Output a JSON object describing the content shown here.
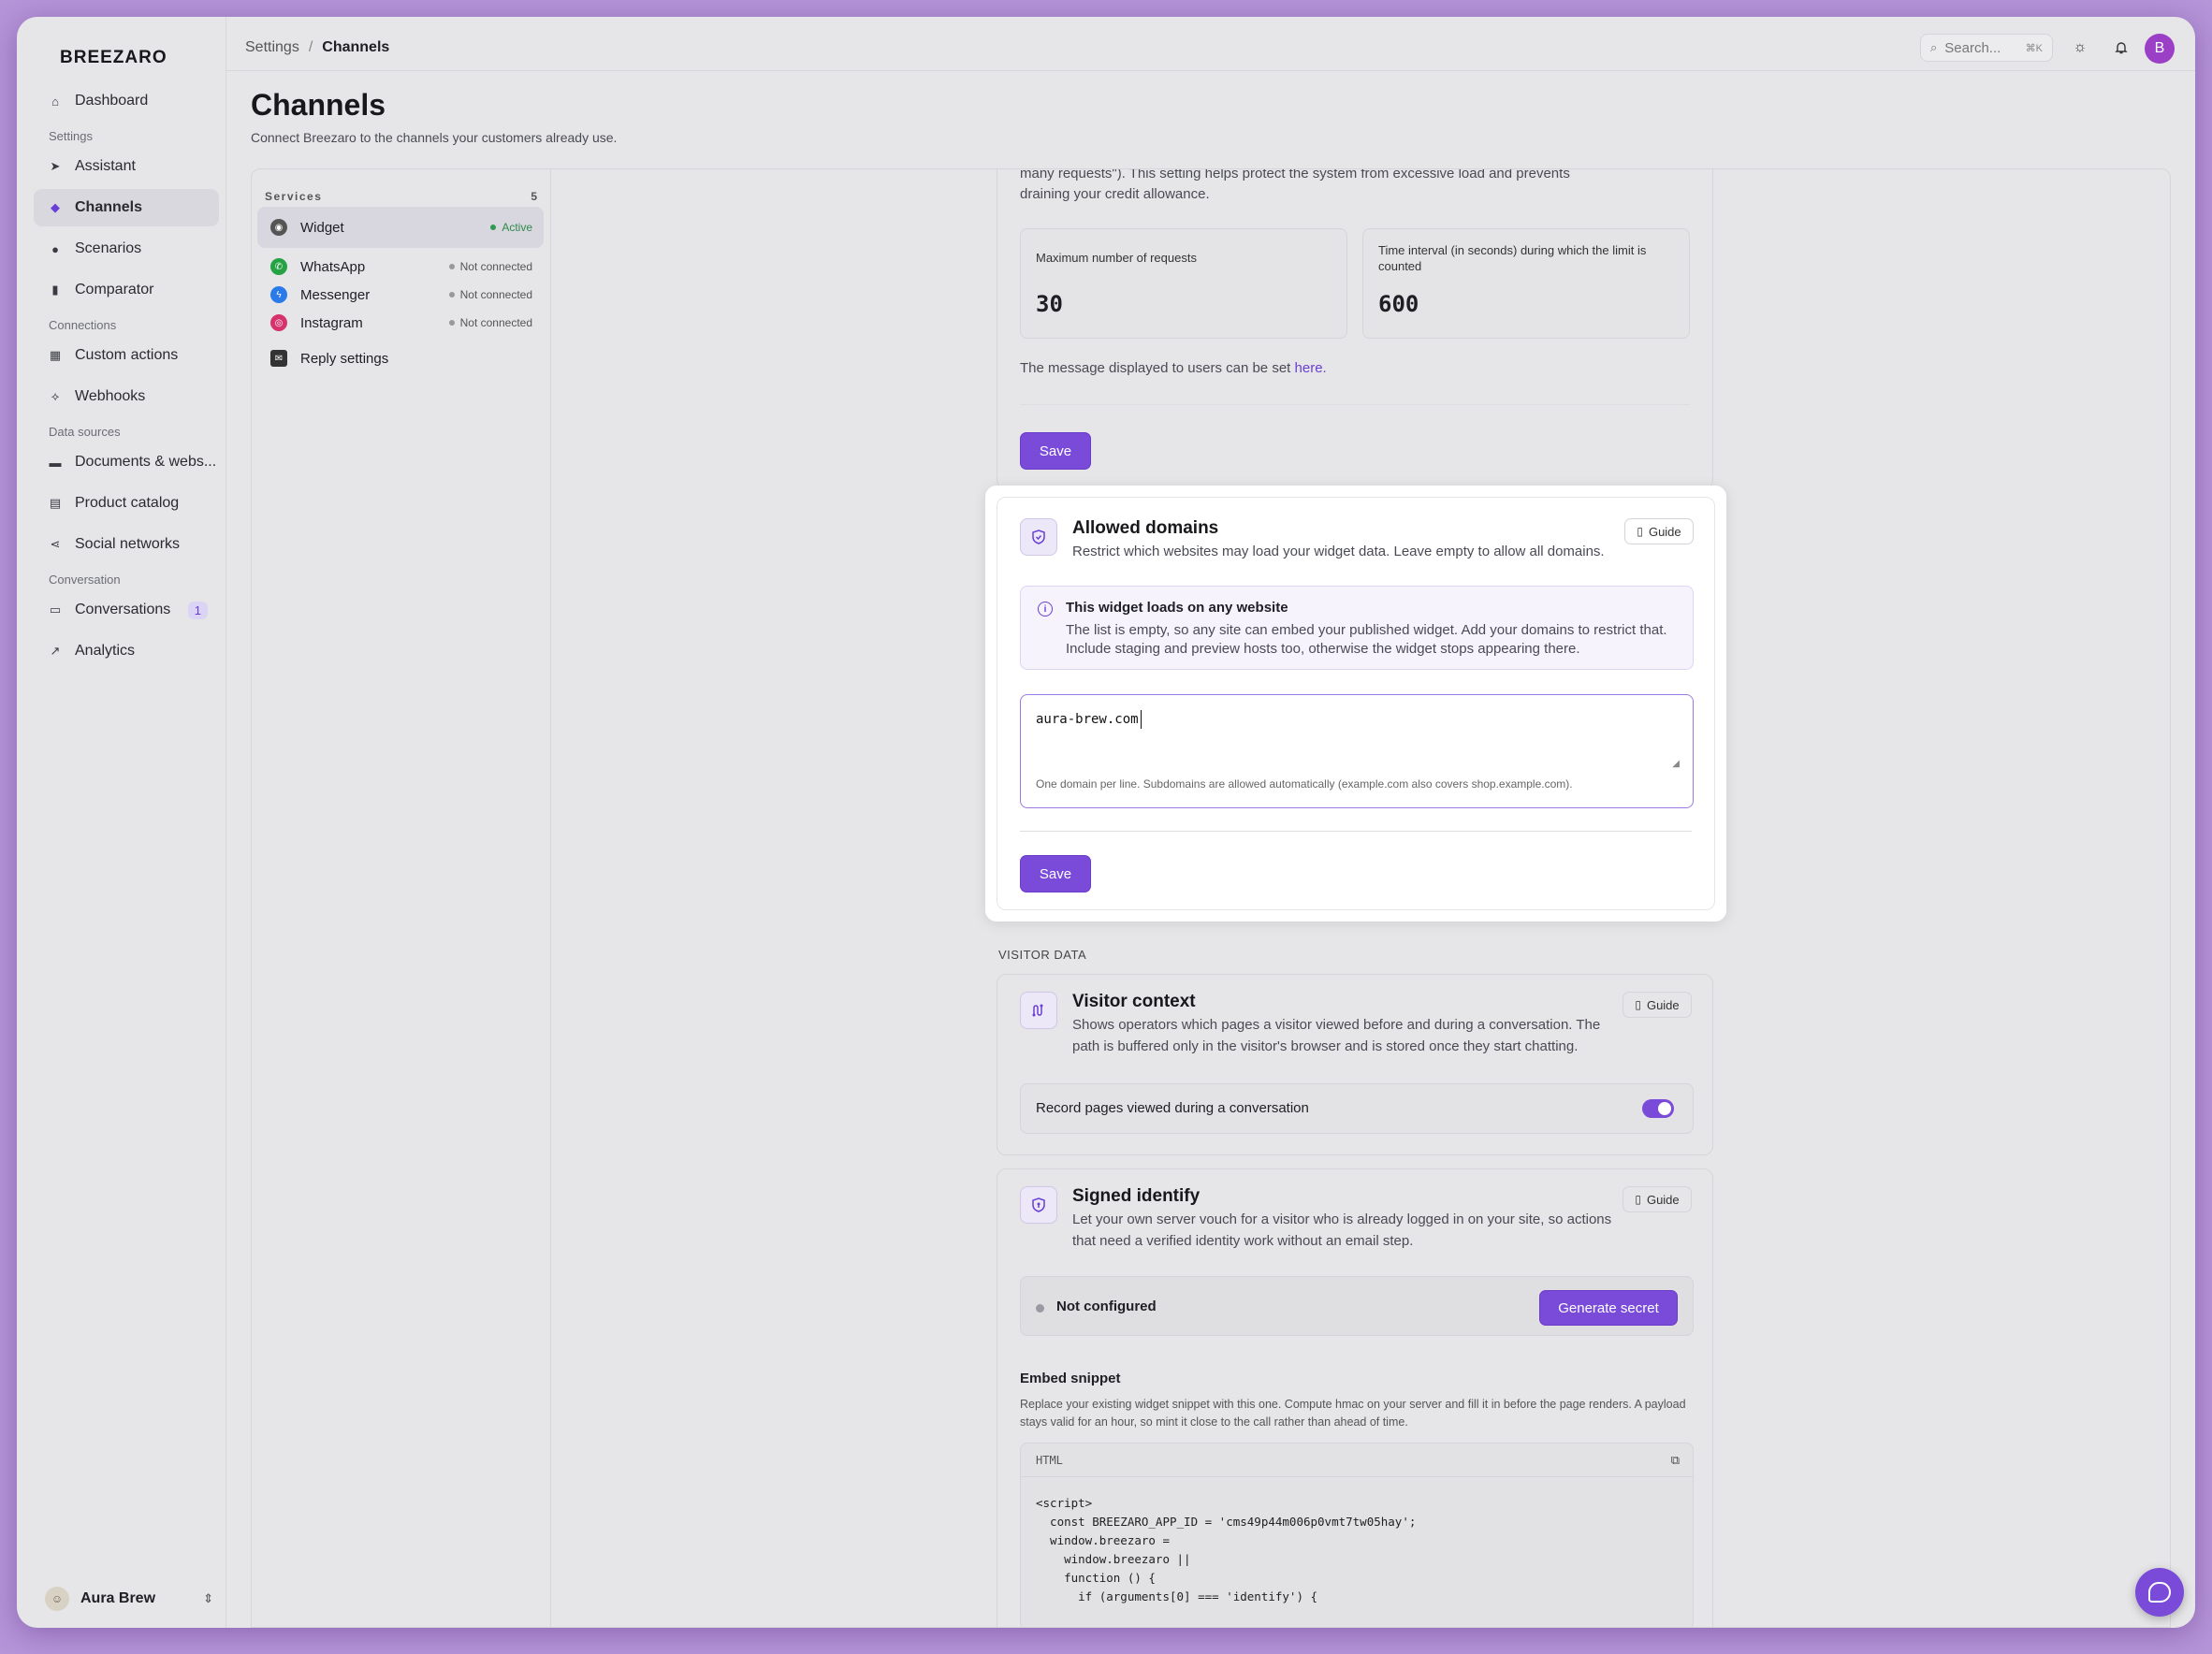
{
  "app": {
    "logo": "BREEZARO"
  },
  "sidebar": {
    "items": [
      {
        "label": "Dashboard",
        "icon": "home-icon"
      },
      {
        "section": "Settings"
      },
      {
        "label": "Assistant",
        "icon": "send-icon"
      },
      {
        "label": "Channels",
        "icon": "puzzle-icon",
        "active": true
      },
      {
        "label": "Scenarios",
        "icon": "chat-icon"
      },
      {
        "label": "Comparator",
        "icon": "columns-icon"
      },
      {
        "section": "Connections"
      },
      {
        "label": "Custom actions",
        "icon": "grid-icon"
      },
      {
        "label": "Webhooks",
        "icon": "webhook-icon"
      },
      {
        "section": "Data sources"
      },
      {
        "label": "Documents & webs...",
        "icon": "folder-icon"
      },
      {
        "label": "Product catalog",
        "icon": "store-icon"
      },
      {
        "label": "Social networks",
        "icon": "share-icon"
      },
      {
        "section": "Conversation"
      },
      {
        "label": "Conversations",
        "icon": "message-icon",
        "count": "1"
      },
      {
        "label": "Analytics",
        "icon": "chart-icon"
      }
    ],
    "org": {
      "name": "Aura Brew"
    }
  },
  "topbar": {
    "crumb_root": "Settings",
    "crumb_sep": "/",
    "crumb_current": "Channels",
    "search_placeholder": "Search...",
    "search_kbd": "⌘K",
    "avatar_letter": "B"
  },
  "page": {
    "title": "Channels",
    "subtitle": "Connect Breezaro to the channels your customers already use."
  },
  "services": {
    "header": "Services",
    "count": "5",
    "items": [
      {
        "label": "Widget",
        "status": "Active",
        "active": true,
        "icon": "widget-icon",
        "color": "#555555"
      },
      {
        "label": "WhatsApp",
        "status": "Not connected",
        "icon": "whatsapp-icon",
        "color": "#25a244"
      },
      {
        "label": "Messenger",
        "status": "Not connected",
        "icon": "messenger-icon",
        "color": "#2a7ae8"
      },
      {
        "label": "Instagram",
        "status": "Not connected",
        "icon": "instagram-icon",
        "color": "#d6336c"
      },
      {
        "label": "Reply settings",
        "status": "",
        "icon": "reply-settings-icon",
        "color": "#333333"
      }
    ]
  },
  "rate_limit": {
    "desc_line1": "many requests\"). This setting helps protect the system from excessive load and prevents",
    "desc_line2": "draining your credit allowance.",
    "max_label": "Maximum number of requests",
    "max_value": "30",
    "interval_label": "Time interval (in seconds) during which the limit is counted",
    "interval_value": "600",
    "message_note": "The message displayed to users can be set",
    "message_link": "here.",
    "save": "Save"
  },
  "allowed_domains": {
    "title": "Allowed domains",
    "desc": "Restrict which websites may load your widget data. Leave empty to allow all domains.",
    "guide": "Guide",
    "info_title": "This widget loads on any website",
    "info_line1": "The list is empty, so any site can embed your published widget. Add your domains to restrict that.",
    "info_line2": "Include staging and preview hosts too, otherwise the widget stops appearing there.",
    "textarea_value": "aura-brew.com",
    "hint": "One domain per line. Subdomains are allowed automatically (example.com also covers shop.example.com).",
    "save": "Save"
  },
  "visitor_data": {
    "section_label": "VISITOR DATA",
    "title": "Visitor context",
    "desc_line1": "Shows operators which pages a visitor viewed before and during a conversation. The",
    "desc_line2": "path is buffered only in the visitor's browser and is stored once they start chatting.",
    "guide": "Guide",
    "toggle_label": "Record pages viewed during a conversation",
    "toggle_on": true
  },
  "signed_identify": {
    "title": "Signed identify",
    "desc_line1": "Let your own server vouch for a visitor who is already logged in on your site, so actions",
    "desc_line2": "that need a verified identity work without an email step.",
    "guide": "Guide",
    "status": "Not configured",
    "generate": "Generate secret",
    "embed_title": "Embed snippet",
    "embed_line1": "Replace your existing widget snippet with this one. Compute hmac on your server and fill it in before the page renders. A payload",
    "embed_line2": "stays valid for an hour, so mint it close to the call rather than ahead of time.",
    "code_lang": "HTML",
    "code": [
      "<script>",
      "  const BREEZARO_APP_ID = 'cms49p44m006p0vmt7tw05hay';",
      "  window.breezaro =",
      "    window.breezaro ||",
      "    function () {",
      "      if (arguments[0] === 'identify') {"
    ]
  },
  "colors": {
    "accent": "#7a4ad9",
    "active_status": "#2f9a52"
  }
}
